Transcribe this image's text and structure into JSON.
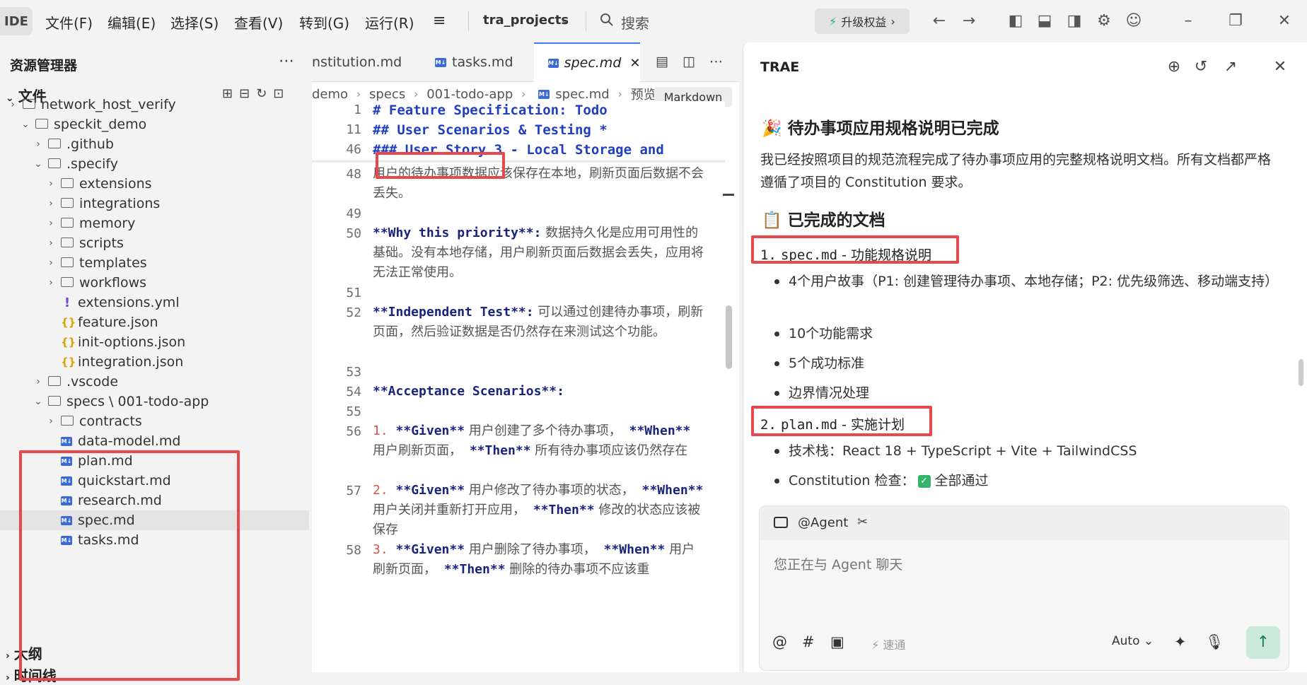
{
  "titlebar": {
    "ide_tag": "IDE",
    "menus": [
      "文件(F)",
      "编辑(E)",
      "选择(S)",
      "查看(V)",
      "转到(G)",
      "运行(R)"
    ],
    "project": "tra_projects",
    "search": "搜索",
    "upgrade": "升级权益"
  },
  "explorer": {
    "title": "资源管理器",
    "section_files": "文件",
    "tree": [
      {
        "label": "network_host_verify",
        "type": "folder"
      },
      {
        "label": "speckit_demo",
        "type": "folder-open"
      },
      {
        "label": ".github",
        "type": "folder"
      },
      {
        "label": ".specify",
        "type": "folder-open"
      },
      {
        "label": "extensions",
        "type": "folder"
      },
      {
        "label": "integrations",
        "type": "folder"
      },
      {
        "label": "memory",
        "type": "folder"
      },
      {
        "label": "scripts",
        "type": "folder"
      },
      {
        "label": "templates",
        "type": "folder"
      },
      {
        "label": "workflows",
        "type": "folder"
      },
      {
        "label": "extensions.yml",
        "type": "yml"
      },
      {
        "label": "feature.json",
        "type": "json"
      },
      {
        "label": "init-options.json",
        "type": "json"
      },
      {
        "label": "integration.json",
        "type": "json"
      },
      {
        "label": ".vscode",
        "type": "folder"
      },
      {
        "label": "specs \\ 001-todo-app",
        "type": "folder-open"
      },
      {
        "label": "contracts",
        "type": "folder"
      },
      {
        "label": "data-model.md",
        "type": "md"
      },
      {
        "label": "plan.md",
        "type": "md"
      },
      {
        "label": "quickstart.md",
        "type": "md"
      },
      {
        "label": "research.md",
        "type": "md"
      },
      {
        "label": "spec.md",
        "type": "md"
      },
      {
        "label": "tasks.md",
        "type": "md"
      }
    ],
    "section_outline": "大纲",
    "section_timeline": "时间线"
  },
  "editor": {
    "tabs": [
      "nstitution.md",
      "tasks.md",
      "spec.md"
    ],
    "breadcrumb": [
      "demo",
      "specs",
      "001-todo-app",
      "spec.md",
      "预览"
    ],
    "mode_badge": "Markdown",
    "sticky": [
      {
        "num": "1",
        "text": "# Feature Specification: Todo"
      },
      {
        "num": "11",
        "text": "## User Scenarios & Testing *"
      },
      {
        "num": "46",
        "text": "### User Story 3 - Local Storage and"
      }
    ],
    "lines": [
      {
        "num": "48",
        "text": "用户的待办事项数据应该保存在本地，刷新页面后数据不会丢失。"
      },
      {
        "num": "49",
        "text": ""
      },
      {
        "num": "50",
        "bold": "**Why this priority**:",
        "text": " 数据持久化是应用可用性的基础。没有本地存储，用户刷新页面后数据会丢失，应用将无法正常使用。"
      },
      {
        "num": "51",
        "text": ""
      },
      {
        "num": "52",
        "bold": "**Independent Test**:",
        "text": " 可以通过创建待办事项，刷新页面，然后验证数据是否仍然存在来测试这个功能。"
      },
      {
        "num": "53",
        "text": ""
      },
      {
        "num": "54",
        "bold": "**Acceptance Scenarios**:",
        "text": ""
      },
      {
        "num": "55",
        "text": ""
      },
      {
        "num": "56",
        "n": "1.",
        "bold": "**Given**",
        "text": " 用户创建了多个待办事项，",
        "bold2": "**When**",
        "text2": " 用户刷新页面，",
        "bold3": "**Then**",
        "text3": " 所有待办事项应该仍然存在"
      },
      {
        "num": "57",
        "n": "2.",
        "bold": "**Given**",
        "text": " 用户修改了待办事项的状态，",
        "bold2": "**When**",
        "text2": " 用户关闭并重新打开应用，",
        "bold3": "**Then**",
        "text3": " 修改的状态应该被保存"
      },
      {
        "num": "58",
        "n": "3.",
        "bold": "**Given**",
        "text": " 用户删除了待办事项，",
        "bold2": "**When**",
        "text2": " 用户刷新页面，",
        "bold3": "**Then**",
        "text3": " 删除的待办事项不应该重"
      }
    ]
  },
  "chat": {
    "title": "TRAE",
    "heading1": "待办事项应用规格说明已完成",
    "para1": "我已经按照项目的规范流程完成了待办事项应用的完整规格说明文档。所有文档都严格遵循了项目的 Constitution 要求。",
    "heading2": "已完成的文档",
    "item1": {
      "num": "1.",
      "file": "spec.md",
      "desc": " - 功能规格说明"
    },
    "item1_bullets": [
      "4个用户故事（P1: 创建管理待办事项、本地存储；P2: 优先级筛选、移动端支持）",
      "10个功能需求",
      "5个成功标准",
      "边界情况处理"
    ],
    "item2": {
      "num": "2.",
      "file": "plan.md",
      "desc": " - 实施计划"
    },
    "item2_bullets": [
      "技术栈：React 18 + TypeScript + Vite + TailwindCSS",
      "Constitution 检查："
    ],
    "check_text": "全部通过",
    "agent_label": "@Agent",
    "input_placeholder": "您正在与 Agent 聊天",
    "speed_label": "速通",
    "mode_label": "Auto"
  },
  "colors": {
    "accent": "#3f7bf2",
    "highlight_box": "#e8474b",
    "success": "#35b36d"
  }
}
